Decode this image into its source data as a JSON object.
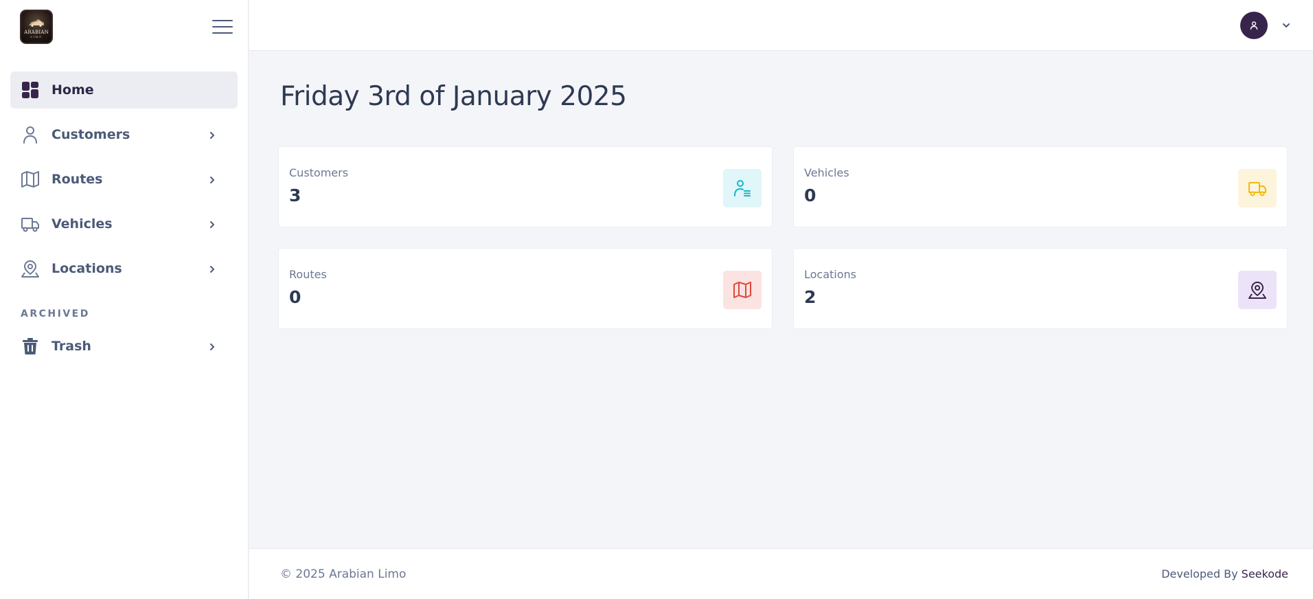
{
  "brand": {
    "logo_text": "ARABIAN",
    "logo_subtext": "LIMO",
    "logo_icon": "limo-emblem-icon"
  },
  "sidebar": {
    "menu_icon": "hamburger-icon",
    "items": [
      {
        "label": "Home",
        "icon": "grid-icon",
        "active": true
      },
      {
        "label": "Customers",
        "icon": "user-icon",
        "active": false
      },
      {
        "label": "Routes",
        "icon": "map-icon",
        "active": false
      },
      {
        "label": "Vehicles",
        "icon": "truck-icon",
        "active": false
      },
      {
        "label": "Locations",
        "icon": "location-pin-icon",
        "active": false
      }
    ],
    "section_archived": "ARCHIVED",
    "archived_items": [
      {
        "label": "Trash",
        "icon": "trash-icon"
      }
    ]
  },
  "header": {
    "avatar_icon": "user-avatar-icon",
    "dropdown_icon": "chevron-down-icon"
  },
  "main": {
    "title": "Friday 3rd of January 2025",
    "stats": [
      {
        "label": "Customers",
        "value": "3",
        "icon": "user-list-icon",
        "color": "#14b8c9",
        "bg": "#e0f6f9"
      },
      {
        "label": "Vehicles",
        "value": "0",
        "icon": "truck-icon",
        "color": "#f2b90c",
        "bg": "#fdf4dc"
      },
      {
        "label": "Routes",
        "value": "0",
        "icon": "map-icon",
        "color": "#e0473b",
        "bg": "#fbe3e1"
      },
      {
        "label": "Locations",
        "value": "2",
        "icon": "location-pin-icon",
        "color": "#38244a",
        "bg": "#ece3f8"
      }
    ]
  },
  "footer": {
    "copyright": "© 2025 Arabian Limo",
    "developed_by": "Developed By ",
    "developer": "Seekode"
  },
  "colors": {
    "accent": "#38244a",
    "nav_text": "#4b5a78",
    "active_bg": "#ebedf2",
    "page_bg": "#f4f5f9"
  }
}
